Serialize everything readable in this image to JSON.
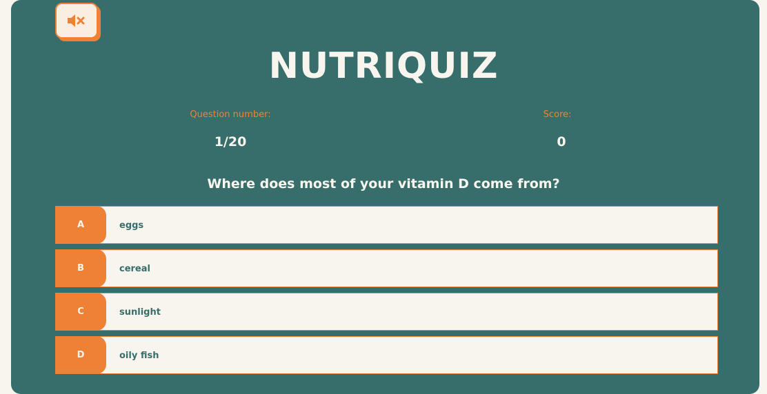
{
  "app": {
    "title": "NUTRIQUIZ",
    "mute_icon": "speaker-muted-icon"
  },
  "stats": {
    "question_label": "Question number:",
    "question_value": "1/20",
    "score_label": "Score:",
    "score_value": "0"
  },
  "quiz": {
    "question": "Where does most of your vitamin D come from?",
    "options": [
      {
        "letter": "A",
        "text": "eggs"
      },
      {
        "letter": "B",
        "text": "cereal"
      },
      {
        "letter": "C",
        "text": "sunlight"
      },
      {
        "letter": "D",
        "text": "oily fish"
      }
    ]
  },
  "colors": {
    "background": "#f8f5ee",
    "card": "#376e6b",
    "accent": "#ef8137",
    "option_text": "#376e6b"
  }
}
